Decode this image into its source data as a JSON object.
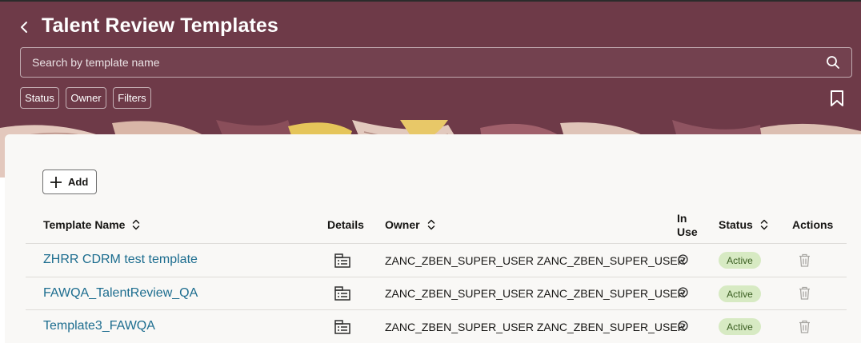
{
  "header": {
    "title": "Talent Review Templates",
    "back_icon": "chevron-left-icon",
    "bookmark_icon": "bookmark-icon",
    "bg_color": "#6e3a48"
  },
  "search": {
    "placeholder": "Search by template name",
    "value": "",
    "icon": "search-icon"
  },
  "filters": {
    "chips": [
      "Status",
      "Owner",
      "Filters"
    ]
  },
  "toolbar": {
    "add_label": "Add"
  },
  "table": {
    "columns": {
      "name": "Template Name",
      "details": "Details",
      "owner": "Owner",
      "in_use_line1": "In",
      "in_use_line2": "Use",
      "status": "Status",
      "actions": "Actions"
    },
    "rows": [
      {
        "name": "ZHRR CDRM test template",
        "owner": "ZANC_ZBEN_SUPER_USER ZANC_ZBEN_SUPER_USER",
        "in_use": true,
        "status": "Active"
      },
      {
        "name": "FAWQA_TalentReview_QA",
        "owner": "ZANC_ZBEN_SUPER_USER ZANC_ZBEN_SUPER_USER",
        "in_use": true,
        "status": "Active"
      },
      {
        "name": "Template3_FAWQA",
        "owner": "ZANC_ZBEN_SUPER_USER ZANC_ZBEN_SUPER_USER",
        "in_use": true,
        "status": "Active"
      }
    ]
  },
  "colors": {
    "link": "#1d6d8f",
    "badge_bg": "#d7eac3",
    "badge_text": "#3a5e21"
  }
}
